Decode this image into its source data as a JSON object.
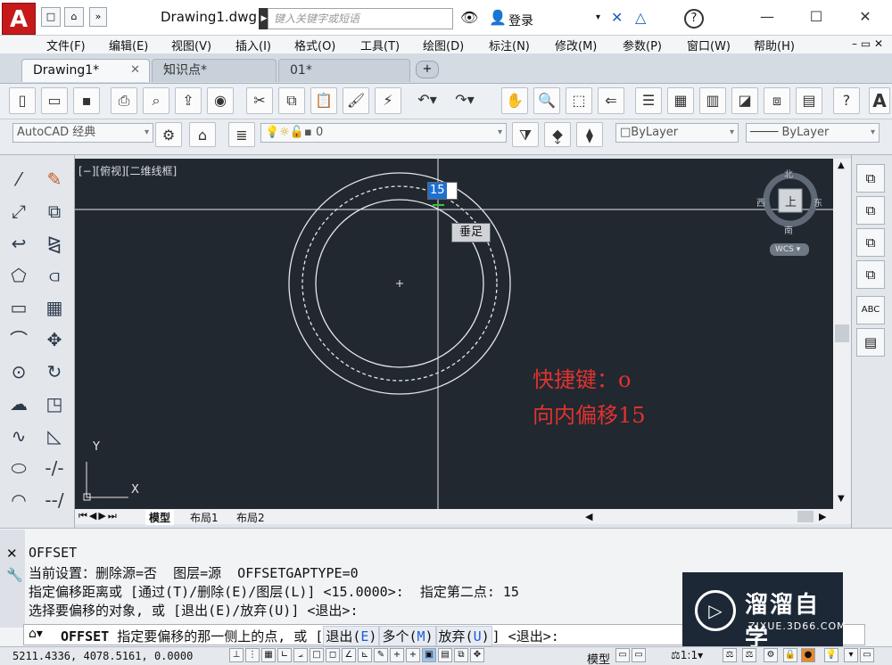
{
  "title_bar": {
    "document_title": "Drawing1.dwg",
    "search_placeholder": "键入关键字或短语",
    "login_label": "登录"
  },
  "menu": [
    "文件(F)",
    "编辑(E)",
    "视图(V)",
    "插入(I)",
    "格式(O)",
    "工具(T)",
    "绘图(D)",
    "标注(N)",
    "修改(M)",
    "参数(P)",
    "窗口(W)",
    "帮助(H)"
  ],
  "tabs": [
    {
      "label": "Drawing1*",
      "active": true
    },
    {
      "label": "知识点*",
      "active": false
    },
    {
      "label": "01*",
      "active": false
    }
  ],
  "workspace": {
    "name": "AutoCAD 经典"
  },
  "layer": {
    "current": "0"
  },
  "properties": {
    "color": "ByLayer",
    "linetype": "ByLayer"
  },
  "viewport": {
    "label": "[−][俯视][二维线框]",
    "dynamic_input_value": "15",
    "snap_tooltip": "垂足",
    "annotation_line1": "快捷键：o",
    "annotation_line2": "向内偏移15",
    "annotation_color": "#e0332f",
    "viewcube": {
      "north": "北",
      "south": "南",
      "east": "东",
      "west": "西",
      "face": "上",
      "wcs": "WCS"
    },
    "ucs": {
      "x": "X",
      "y": "Y"
    }
  },
  "layout_tabs": [
    "模型",
    "布局1",
    "布局2"
  ],
  "command_history": [
    "OFFSET",
    "当前设置：删除源=否  图层=源  OFFSETGAPTYPE=0",
    "指定偏移距离或 [通过(T)/删除(E)/图层(L)] <15.0000>:  指定第二点: 15",
    "选择要偏移的对象, 或 [退出(E)/放弃(U)] <退出>:"
  ],
  "command_prompt": {
    "command": "OFFSET",
    "text": "指定要偏移的那一侧上的点, 或 [",
    "options": [
      {
        "label": "退出(",
        "key": "E",
        "end": ")"
      },
      {
        "label": "多个(",
        "key": "M",
        "end": ")"
      },
      {
        "label": "放弃(",
        "key": "U",
        "end": ")"
      }
    ],
    "tail": "] <退出>:"
  },
  "status_bar": {
    "coordinates": "5211.4336, 4078.5161, 0.0000",
    "model_label": "模型",
    "scale": "1:1"
  },
  "watermark": {
    "brand": "溜溜自学",
    "url": "ZIXUE.3D66.COM"
  }
}
